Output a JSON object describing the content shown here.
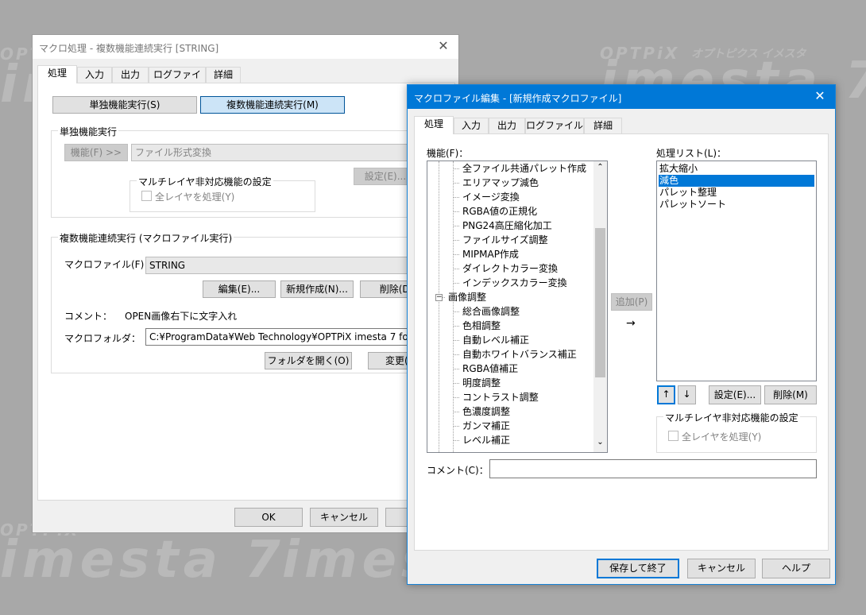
{
  "watermark": {
    "brand_small": "OPTPiX",
    "brand_big": "imesta 7",
    "brand_sub": "オプトピクス イメスタ"
  },
  "main_window": {
    "title": "マクロ処理 - 複数機能連続実行 [STRING]",
    "close": "✕",
    "tabs": [
      "処理",
      "入力",
      "出力",
      "ログファイル",
      "詳細"
    ],
    "mode_single_label": "単独機能実行(S)",
    "mode_multi_label": "複数機能連続実行(M)",
    "single_section": {
      "title": "単独機能実行",
      "function_button": "機能(F) >>",
      "function_value": "ファイル形式変換",
      "settings_button": "設定(E)...",
      "multilayer_group_title": "マルチレイヤ非対応機能の設定",
      "all_layers_label": "全レイヤを処理(Y)"
    },
    "multi_section": {
      "title": "複数機能連続実行 (マクロファイル実行)",
      "macro_file_label": "マクロファイル(F)：",
      "macro_file_value": "STRING",
      "edit_button": "編集(E)...",
      "new_button": "新規作成(N)...",
      "delete_button": "削除(D)",
      "comment_label": "コメント：",
      "comment_value": "OPEN画像右下に文字入れ",
      "folder_label": "マクロフォルダ：",
      "folder_value": "C:¥ProgramData¥Web Technology¥OPTPiX imesta 7 for",
      "open_folder_button": "フォルダを開く(O)",
      "change_button": "変更(L)"
    },
    "ok_button": "OK",
    "cancel_button": "キャンセル"
  },
  "editor_window": {
    "title": "マクロファイル編集 - [新規作成マクロファイル]",
    "close": "✕",
    "tabs": [
      "処理",
      "入力",
      "出力",
      "ログファイル",
      "詳細"
    ],
    "functions_label": "機能(F)：",
    "tree_items": [
      {
        "label": "全ファイル共通パレット作成",
        "level": 1
      },
      {
        "label": "エリアマップ減色",
        "level": 1
      },
      {
        "label": "イメージ変換",
        "level": 1
      },
      {
        "label": "RGBA値の正規化",
        "level": 1
      },
      {
        "label": "PNG24高圧縮化加工",
        "level": 1
      },
      {
        "label": "ファイルサイズ調整",
        "level": 1
      },
      {
        "label": "MIPMAP作成",
        "level": 1
      },
      {
        "label": "ダイレクトカラー変換",
        "level": 1
      },
      {
        "label": "インデックスカラー変換",
        "level": 1
      },
      {
        "label": "画像調整",
        "level": 0
      },
      {
        "label": "総合画像調整",
        "level": 1
      },
      {
        "label": "色相調整",
        "level": 1
      },
      {
        "label": "自動レベル補正",
        "level": 1
      },
      {
        "label": "自動ホワイトバランス補正",
        "level": 1
      },
      {
        "label": "RGBA値補正",
        "level": 1
      },
      {
        "label": "明度調整",
        "level": 1
      },
      {
        "label": "コントラスト調整",
        "level": 1
      },
      {
        "label": "色濃度調整",
        "level": 1
      },
      {
        "label": "ガンマ補正",
        "level": 1
      },
      {
        "label": "レベル補正",
        "level": 1
      }
    ],
    "collapse_glyph": "−",
    "add_button": "追加(P)",
    "arrow_glyph": "→",
    "process_list_label": "処理リスト(L)：",
    "process_list": [
      "拡大縮小",
      "減色",
      "パレット整理",
      "パレットソート"
    ],
    "selected_index": 1,
    "up_glyph": "↑",
    "down_glyph": "↓",
    "settings_button": "設定(E)...",
    "delete_button": "削除(M)",
    "multilayer_group_title": "マルチレイヤ非対応機能の設定",
    "all_layers_label": "全レイヤを処理(Y)",
    "comment_label": "コメント(C)：",
    "comment_value": "",
    "save_button": "保存して終了",
    "cancel_button": "キャンセル",
    "help_button": "ヘルプ"
  },
  "colors": {
    "background": "#a8a8a8",
    "window": "#f0f0f0",
    "accent": "#0078d7",
    "selection": "#0078d7",
    "editor_border": "#1883d7"
  }
}
